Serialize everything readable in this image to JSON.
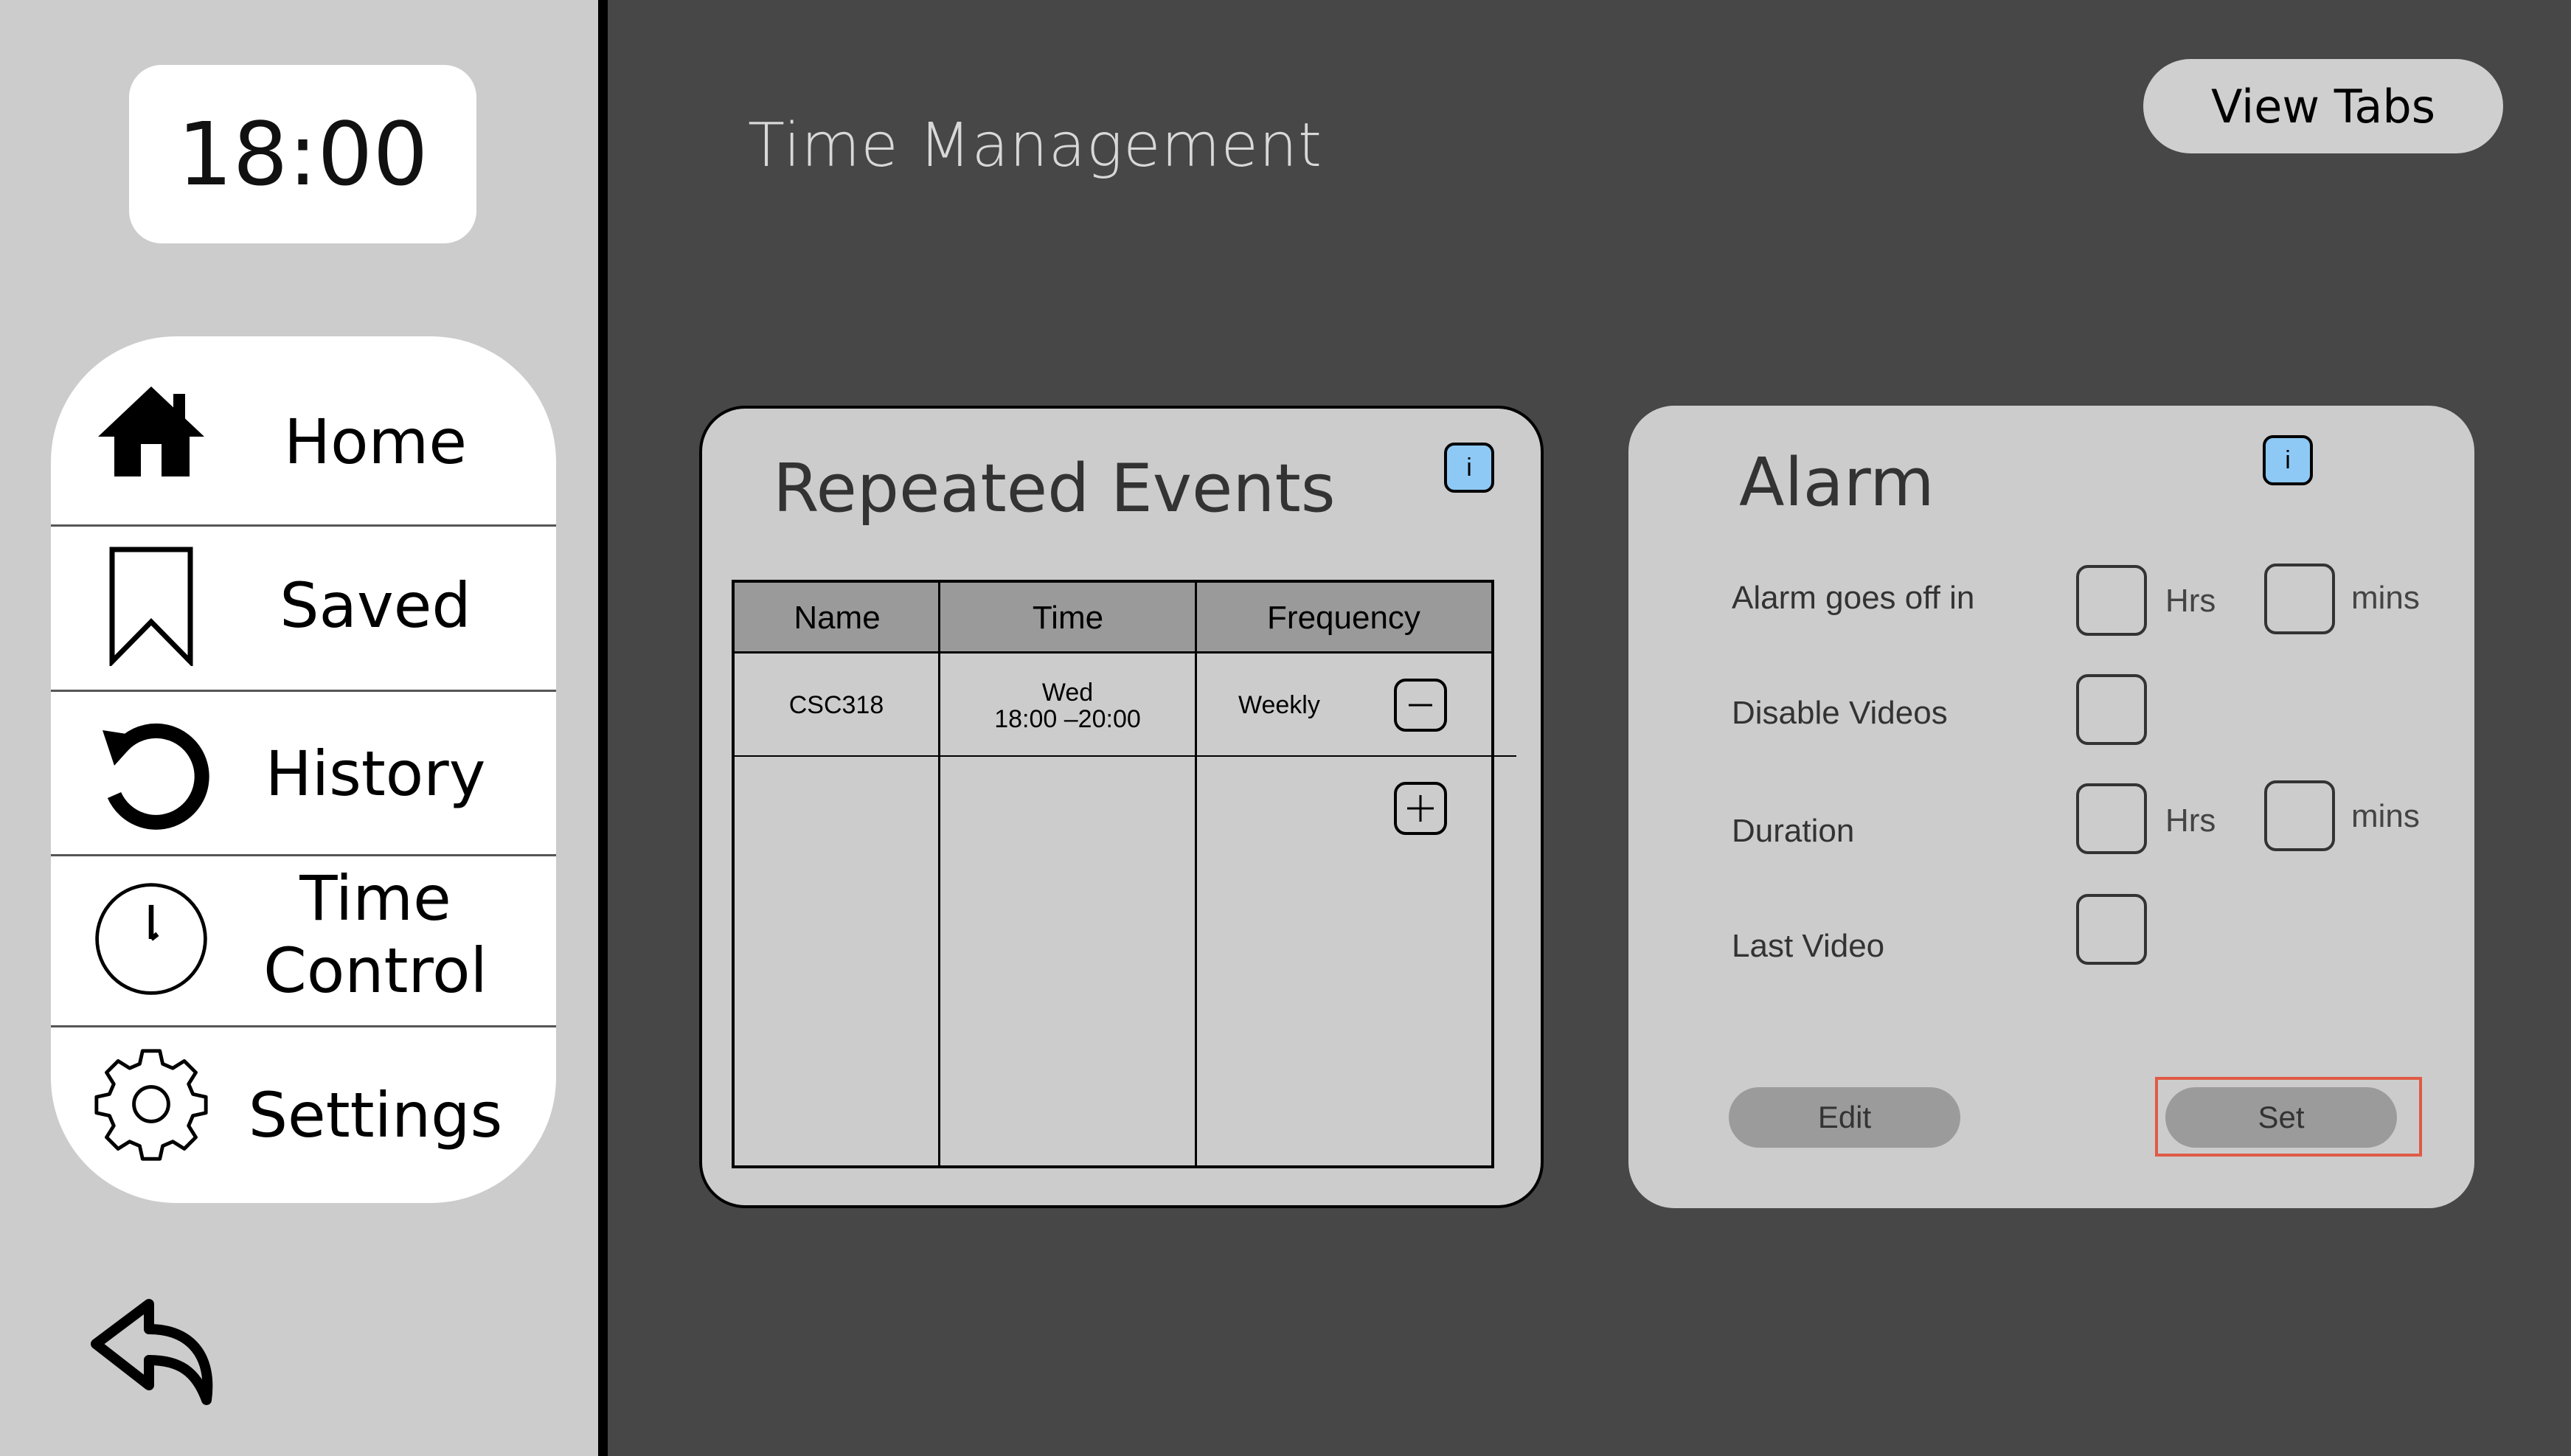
{
  "clock": {
    "time": "18:00"
  },
  "nav": {
    "items": [
      {
        "label": "Home",
        "icon": "home-icon"
      },
      {
        "label": "Saved",
        "icon": "bookmark-icon"
      },
      {
        "label": "History",
        "icon": "history-icon"
      },
      {
        "label": "Time\nControl",
        "icon": "clock-icon"
      },
      {
        "label": "Settings",
        "icon": "gear-icon"
      }
    ],
    "back_icon": "back-arrow-icon"
  },
  "header": {
    "title": "Time Management",
    "view_tabs_label": "View Tabs"
  },
  "repeated_events": {
    "title": "Repeated Events",
    "info_label": "i",
    "columns": [
      "Name",
      "Time",
      "Frequency"
    ],
    "rows": [
      {
        "name": "CSC318",
        "day": "Wed",
        "time": "18:00 –20:00",
        "frequency": "Weekly"
      }
    ]
  },
  "alarm": {
    "title": "Alarm",
    "info_label": "i",
    "fields": {
      "goes_off_in": {
        "label": "Alarm goes off in",
        "unit1": "Hrs",
        "unit2": "mins"
      },
      "disable_videos": {
        "label": "Disable Videos"
      },
      "duration": {
        "label": "Duration",
        "unit1": "Hrs",
        "unit2": "mins"
      },
      "last_video": {
        "label": "Last Video"
      }
    },
    "edit_label": "Edit",
    "set_label": "Set"
  },
  "colors": {
    "background": "#474747",
    "sidebar": "#cccccc",
    "card": "#cccccc",
    "info_accent": "#8ec9f5",
    "highlight": "#e05a45"
  }
}
